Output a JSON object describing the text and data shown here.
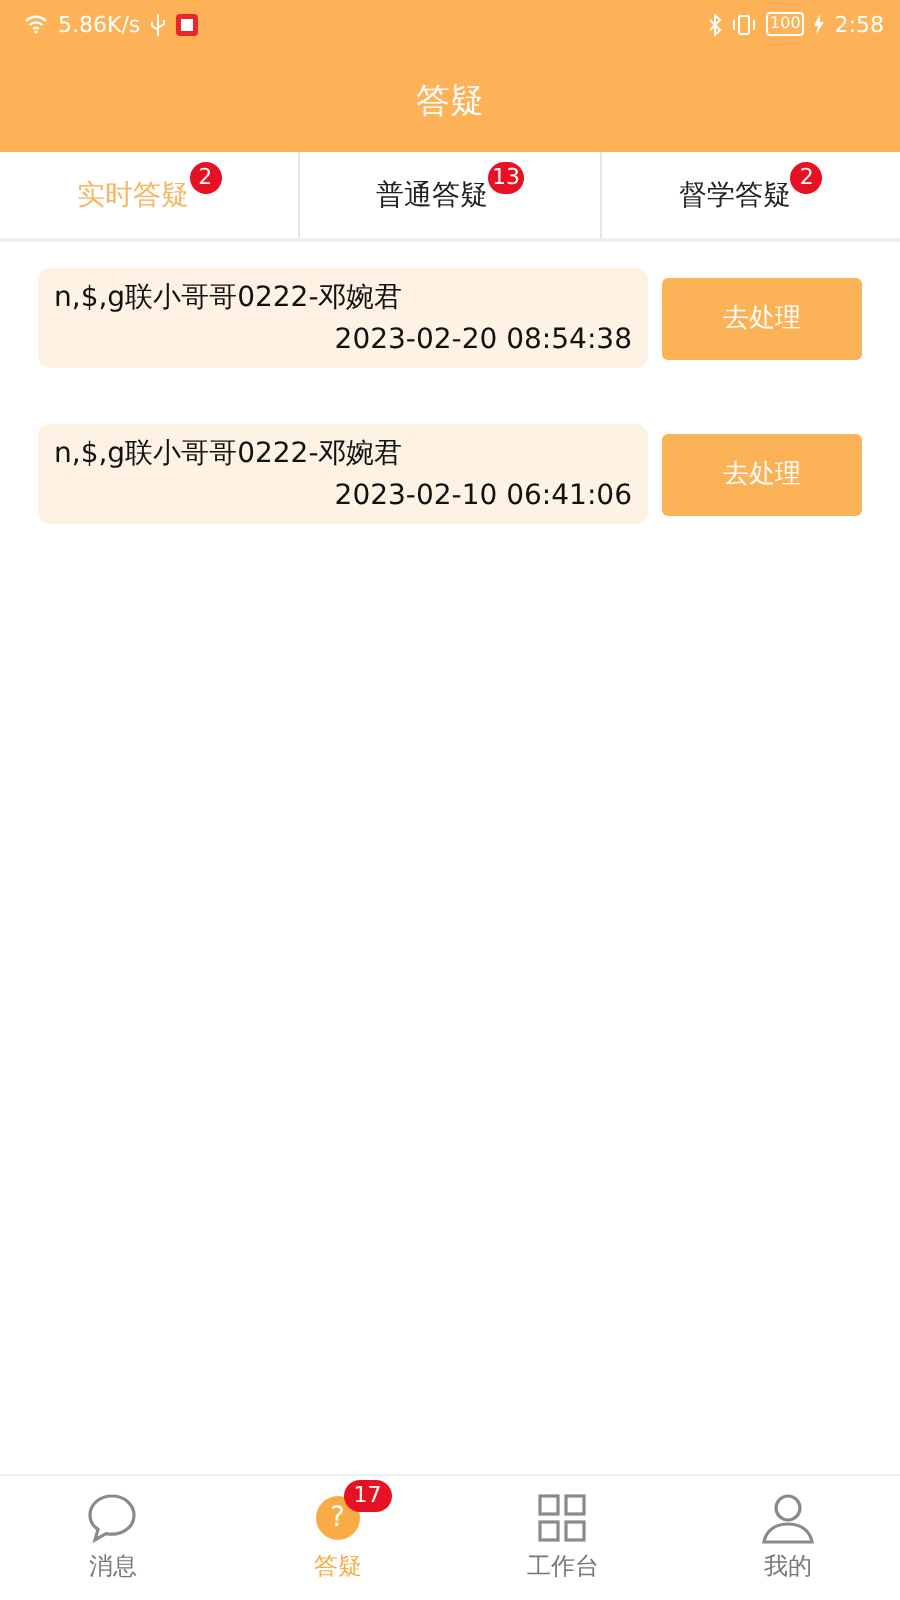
{
  "status_bar": {
    "speed": "5.86K/s",
    "battery": "100",
    "time": "2:58"
  },
  "header": {
    "title": "答疑"
  },
  "tabs": [
    {
      "label": "实时答疑",
      "badge": "2",
      "selected": true
    },
    {
      "label": "普通答疑",
      "badge": "13",
      "selected": false
    },
    {
      "label": "督学答疑",
      "badge": "2",
      "selected": false
    }
  ],
  "items": [
    {
      "name": "n,$,g联小哥哥0222-邓婉君",
      "time": "2023-02-20 08:54:38",
      "action": "去处理"
    },
    {
      "name": "n,$,g联小哥哥0222-邓婉君",
      "time": "2023-02-10 06:41:06",
      "action": "去处理"
    }
  ],
  "bottom_nav": [
    {
      "kind": "chat",
      "label": "消息",
      "selected": false
    },
    {
      "kind": "question",
      "glyph": "?",
      "label": "答疑",
      "badge": "17",
      "selected": true
    },
    {
      "kind": "grid",
      "label": "工作台",
      "selected": false
    },
    {
      "kind": "person",
      "label": "我的",
      "selected": false
    }
  ]
}
